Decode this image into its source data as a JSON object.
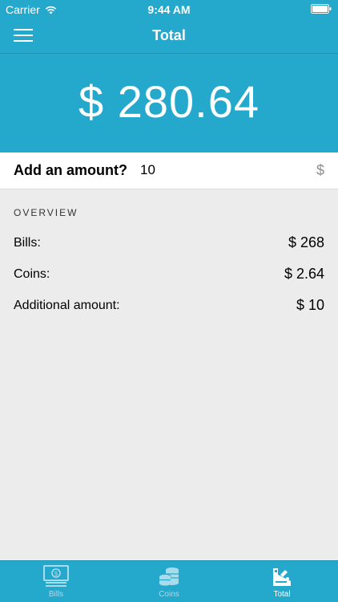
{
  "status_bar": {
    "carrier": "Carrier",
    "time": "9:44 AM"
  },
  "nav": {
    "title": "Total"
  },
  "hero": {
    "total": "$ 280.64"
  },
  "add_amount": {
    "label": "Add an amount?",
    "value": "10",
    "currency": "$"
  },
  "overview": {
    "header": "OVERVIEW",
    "rows": [
      {
        "label": "Bills:",
        "value": "$ 268"
      },
      {
        "label": "Coins:",
        "value": "$ 2.64"
      },
      {
        "label": "Additional amount:",
        "value": "$ 10"
      }
    ]
  },
  "tabs": [
    {
      "label": "Bills",
      "icon": "bills-icon",
      "active": false
    },
    {
      "label": "Coins",
      "icon": "coins-icon",
      "active": false
    },
    {
      "label": "Total",
      "icon": "total-icon",
      "active": true
    }
  ],
  "colors": {
    "primary": "#24a8cc",
    "background": "#ececec",
    "tab_inactive": "#a9dceb",
    "white": "#ffffff"
  }
}
